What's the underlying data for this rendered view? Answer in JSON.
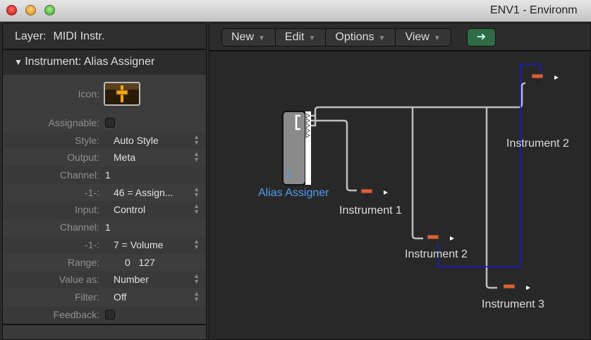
{
  "window": {
    "title": "ENV1 - Environm"
  },
  "inspector": {
    "layer_label": "Layer:",
    "layer_value": "MIDI Instr.",
    "instrument_header": "Instrument: Alias Assigner",
    "icon_label": "Icon:",
    "rows": [
      {
        "label": "Assignable:",
        "type": "checkbox",
        "checked": false
      },
      {
        "label": "Style:",
        "value": "Auto Style",
        "type": "popup"
      },
      {
        "label": "Output:",
        "value": "Meta",
        "type": "popup"
      },
      {
        "label": "Channel:",
        "value": "1",
        "type": "number"
      },
      {
        "label": "-1-:",
        "value": "46 = Assign...",
        "type": "popup"
      },
      {
        "label": "Input:",
        "value": "Control",
        "type": "popup"
      },
      {
        "label": "Channel:",
        "value": "1",
        "type": "number"
      },
      {
        "label": "-1-:",
        "value": "7 = Volume",
        "type": "popup"
      },
      {
        "label": "Range:",
        "value": "0   127",
        "type": "range"
      },
      {
        "label": "Value as:",
        "value": "Number",
        "type": "popup"
      },
      {
        "label": "Filter:",
        "value": "Off",
        "type": "popup"
      },
      {
        "label": "Feedback:",
        "type": "checkbox",
        "checked": false
      }
    ]
  },
  "toolbar": {
    "menus": [
      "New",
      "Edit",
      "Options",
      "View"
    ]
  },
  "canvas": {
    "assigner": {
      "label": "Alias Assigner",
      "number": "1",
      "color": "#4f9cf0"
    },
    "instruments": [
      "Instrument 1",
      "Instrument 2",
      "Instrument 3",
      "Instrument 2"
    ]
  }
}
